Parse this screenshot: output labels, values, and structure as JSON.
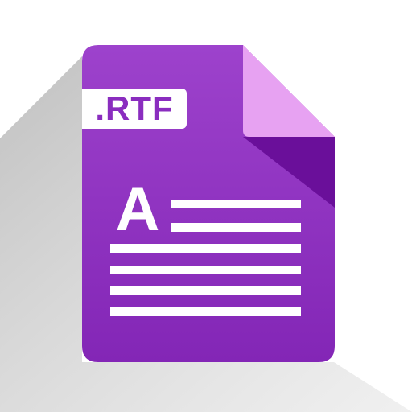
{
  "icon": {
    "name": "rtf-file-icon",
    "extension_label": ".RTF",
    "glyph": "A",
    "text_line_icon": "text-lines-icon"
  },
  "colors": {
    "background": "#ffffff",
    "shadow": "#c8c8c8",
    "page_top": "#9b3fcb",
    "page_bottom": "#7f24b4",
    "fold_light": "#e7a2f2",
    "fold_dark": "#6a0f9a",
    "lines": "#ffffff",
    "label": "#8a2dbf"
  }
}
